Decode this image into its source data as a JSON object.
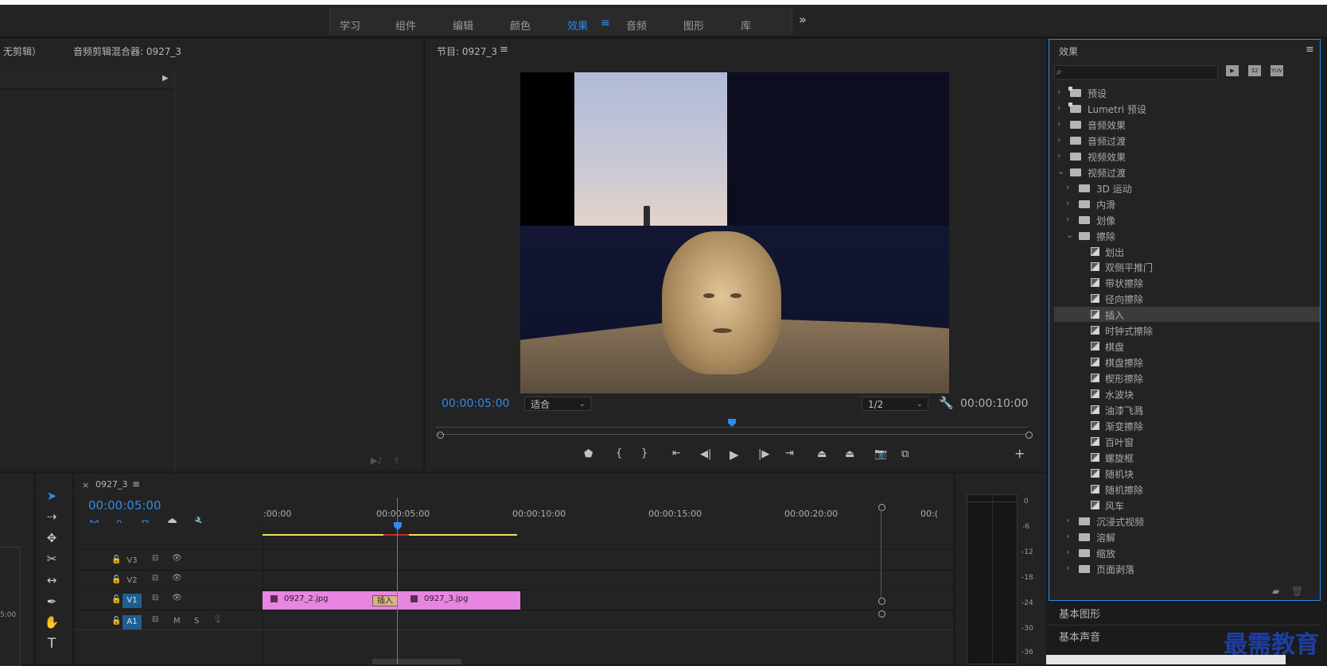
{
  "workspace_tabs": [
    "学习",
    "组件",
    "编辑",
    "颜色",
    "效果",
    "音频",
    "图形",
    "库"
  ],
  "workspace_active": "效果",
  "workspace_menu_glyph": "≡",
  "workspace_more": "»",
  "source_panel": {
    "tab_no_clip": "无剪辑）",
    "audio_mixer": "音频剪辑混合器: 0927_3",
    "play_glyph": "▶"
  },
  "program": {
    "title": "节目: 0927_3",
    "menu": "≡",
    "current_tc": "00:00:05:00",
    "fit_label": "适合",
    "resolution": "1/2",
    "duration_tc": "00:00:10:00",
    "playhead_fraction": 0.5
  },
  "effects": {
    "title": "效果",
    "menu": "≡",
    "search_glyph": "⌕",
    "filter_icons": [
      "加速效果",
      "32位",
      "YUV"
    ],
    "items": [
      {
        "label": "预设",
        "depth": 0,
        "kind": "folder-special",
        "open": false
      },
      {
        "label": "Lumetri 预设",
        "depth": 0,
        "kind": "folder-special",
        "open": false
      },
      {
        "label": "音频效果",
        "depth": 0,
        "kind": "folder",
        "open": false
      },
      {
        "label": "音频过渡",
        "depth": 0,
        "kind": "folder",
        "open": false
      },
      {
        "label": "视频效果",
        "depth": 0,
        "kind": "folder",
        "open": false
      },
      {
        "label": "视频过渡",
        "depth": 0,
        "kind": "folder",
        "open": true
      },
      {
        "label": "3D 运动",
        "depth": 1,
        "kind": "folder",
        "open": false
      },
      {
        "label": "内滑",
        "depth": 1,
        "kind": "folder",
        "open": false
      },
      {
        "label": "划像",
        "depth": 1,
        "kind": "folder",
        "open": false
      },
      {
        "label": "擦除",
        "depth": 1,
        "kind": "folder",
        "open": true
      },
      {
        "label": "划出",
        "depth": 2,
        "kind": "effect"
      },
      {
        "label": "双侧平推门",
        "depth": 2,
        "kind": "effect"
      },
      {
        "label": "带状擦除",
        "depth": 2,
        "kind": "effect"
      },
      {
        "label": "径向擦除",
        "depth": 2,
        "kind": "effect"
      },
      {
        "label": "插入",
        "depth": 2,
        "kind": "effect",
        "selected": true
      },
      {
        "label": "时钟式擦除",
        "depth": 2,
        "kind": "effect"
      },
      {
        "label": "棋盘",
        "depth": 2,
        "kind": "effect"
      },
      {
        "label": "棋盘擦除",
        "depth": 2,
        "kind": "effect"
      },
      {
        "label": "楔形擦除",
        "depth": 2,
        "kind": "effect"
      },
      {
        "label": "水波块",
        "depth": 2,
        "kind": "effect"
      },
      {
        "label": "油漆飞溅",
        "depth": 2,
        "kind": "effect"
      },
      {
        "label": "渐变擦除",
        "depth": 2,
        "kind": "effect"
      },
      {
        "label": "百叶窗",
        "depth": 2,
        "kind": "effect"
      },
      {
        "label": "螺旋框",
        "depth": 2,
        "kind": "effect"
      },
      {
        "label": "随机块",
        "depth": 2,
        "kind": "effect"
      },
      {
        "label": "随机擦除",
        "depth": 2,
        "kind": "effect"
      },
      {
        "label": "风车",
        "depth": 2,
        "kind": "effect"
      },
      {
        "label": "沉浸式视频",
        "depth": 1,
        "kind": "folder",
        "open": false
      },
      {
        "label": "溶解",
        "depth": 1,
        "kind": "folder",
        "open": false
      },
      {
        "label": "缩放",
        "depth": 1,
        "kind": "folder",
        "open": false
      },
      {
        "label": "页面剥落",
        "depth": 1,
        "kind": "folder",
        "open": false
      }
    ]
  },
  "bottom_panels": [
    "基本图形",
    "基本声音"
  ],
  "timeline": {
    "close": "×",
    "sequence": "0927_3",
    "menu": "≡",
    "current_tc": "00:00:05:00",
    "ruler": [
      ":00:00",
      "00:00:05:00",
      "00:00:10:00",
      "00:00:15:00",
      "00:00:20:00",
      "00:("
    ],
    "tracks": [
      "V3",
      "V2",
      "V1",
      "A1"
    ],
    "clips": [
      {
        "name": "0927_2.jpg"
      },
      {
        "name": "0927_3.jpg"
      }
    ],
    "transition_label": "插入",
    "audio_toggles": [
      "M",
      "S"
    ]
  },
  "meter_db": [
    "0",
    "-6",
    "-12",
    "-18",
    "-24",
    "-30",
    "-36"
  ],
  "left_edge_tc": "5:00",
  "watermark": "最需教育",
  "colors": {
    "accent": "#2d8ceb",
    "clip": "#e785e0",
    "selected": "#3b3b3b"
  }
}
